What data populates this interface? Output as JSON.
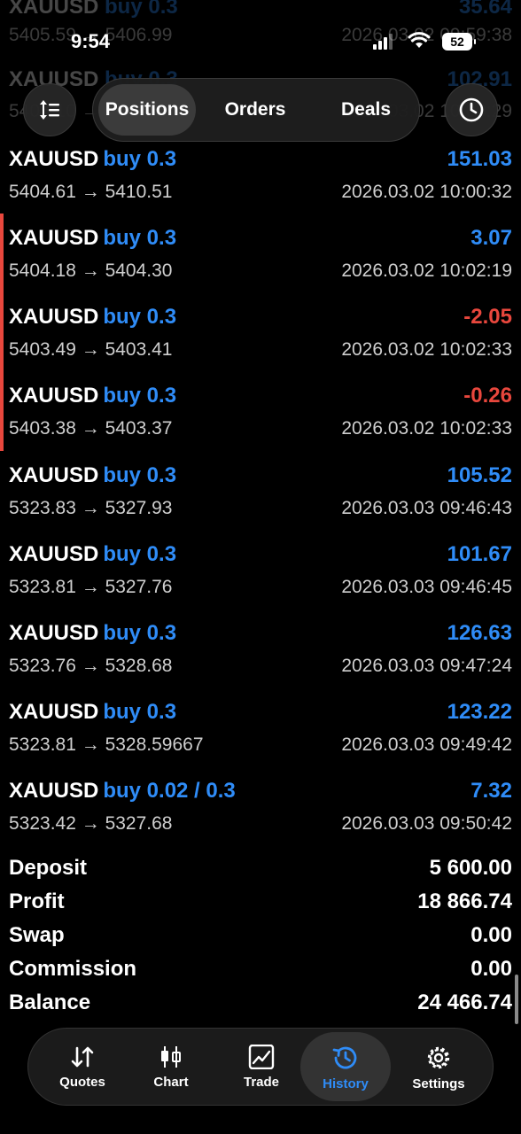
{
  "status_bar": {
    "time": "9:54",
    "battery": "52"
  },
  "ghost_rows": [
    {
      "symbol": "XAUUSD",
      "side": "buy 0.3",
      "value": "35.64",
      "prices": "5405.59 → 5406.99",
      "time": "2026.03.02 09:59:38"
    },
    {
      "symbol": "XAUUSD",
      "side": "buy 0.3",
      "value": "102.91",
      "prices": "5405.10 → 5410.",
      "time": "2026.03.02 10:00:29"
    }
  ],
  "header": {
    "tabs": [
      {
        "label": "Positions",
        "active": true
      },
      {
        "label": "Orders",
        "active": false
      },
      {
        "label": "Deals",
        "active": false
      }
    ]
  },
  "deals": [
    {
      "symbol": "XAUUSD",
      "side": "buy 0.3",
      "profit": "151.03",
      "prices": "5404.61 → 5410.51",
      "time": "2026.03.02 10:00:32",
      "color": "#2f8cf7",
      "marker": false
    },
    {
      "symbol": "XAUUSD",
      "side": "buy 0.3",
      "profit": "3.07",
      "prices": "5404.18 → 5404.30",
      "time": "2026.03.02 10:02:19",
      "color": "#2f8cf7",
      "marker": true
    },
    {
      "symbol": "XAUUSD",
      "side": "buy 0.3",
      "profit": "-2.05",
      "prices": "5403.49 → 5403.41",
      "time": "2026.03.02 10:02:33",
      "color": "#e8473d",
      "marker": true
    },
    {
      "symbol": "XAUUSD",
      "side": "buy 0.3",
      "profit": "-0.26",
      "prices": "5403.38 → 5403.37",
      "time": "2026.03.02 10:02:33",
      "color": "#e8473d",
      "marker": true
    },
    {
      "symbol": "XAUUSD",
      "side": "buy 0.3",
      "profit": "105.52",
      "prices": "5323.83 → 5327.93",
      "time": "2026.03.03 09:46:43",
      "color": "#2f8cf7",
      "marker": false
    },
    {
      "symbol": "XAUUSD",
      "side": "buy 0.3",
      "profit": "101.67",
      "prices": "5323.81 → 5327.76",
      "time": "2026.03.03 09:46:45",
      "color": "#2f8cf7",
      "marker": false
    },
    {
      "symbol": "XAUUSD",
      "side": "buy 0.3",
      "profit": "126.63",
      "prices": "5323.76 → 5328.68",
      "time": "2026.03.03 09:47:24",
      "color": "#2f8cf7",
      "marker": false
    },
    {
      "symbol": "XAUUSD",
      "side": "buy 0.3",
      "profit": "123.22",
      "prices": "5323.81 → 5328.59667",
      "time": "2026.03.03 09:49:42",
      "color": "#2f8cf7",
      "marker": false
    },
    {
      "symbol": "XAUUSD",
      "side": "buy 0.02 / 0.3",
      "profit": "7.32",
      "prices": "5323.42 → 5327.68",
      "time": "2026.03.03 09:50:42",
      "color": "#2f8cf7",
      "marker": false
    }
  ],
  "summary": [
    {
      "label": "Deposit",
      "value": "5 600.00"
    },
    {
      "label": "Profit",
      "value": "18 866.74"
    },
    {
      "label": "Swap",
      "value": "0.00"
    },
    {
      "label": "Commission",
      "value": "0.00"
    },
    {
      "label": "Balance",
      "value": "24 466.74"
    }
  ],
  "bottom_nav": [
    {
      "label": "Quotes",
      "icon": "quotes-icon",
      "active": false
    },
    {
      "label": "Chart",
      "icon": "chart-icon",
      "active": false
    },
    {
      "label": "Trade",
      "icon": "trade-icon",
      "active": false
    },
    {
      "label": "History",
      "icon": "history-icon",
      "active": true
    },
    {
      "label": "Settings",
      "icon": "settings-icon",
      "active": false
    }
  ],
  "colors": {
    "accent": "#2f8cf7",
    "loss": "#e8473d",
    "background": "#000000"
  }
}
